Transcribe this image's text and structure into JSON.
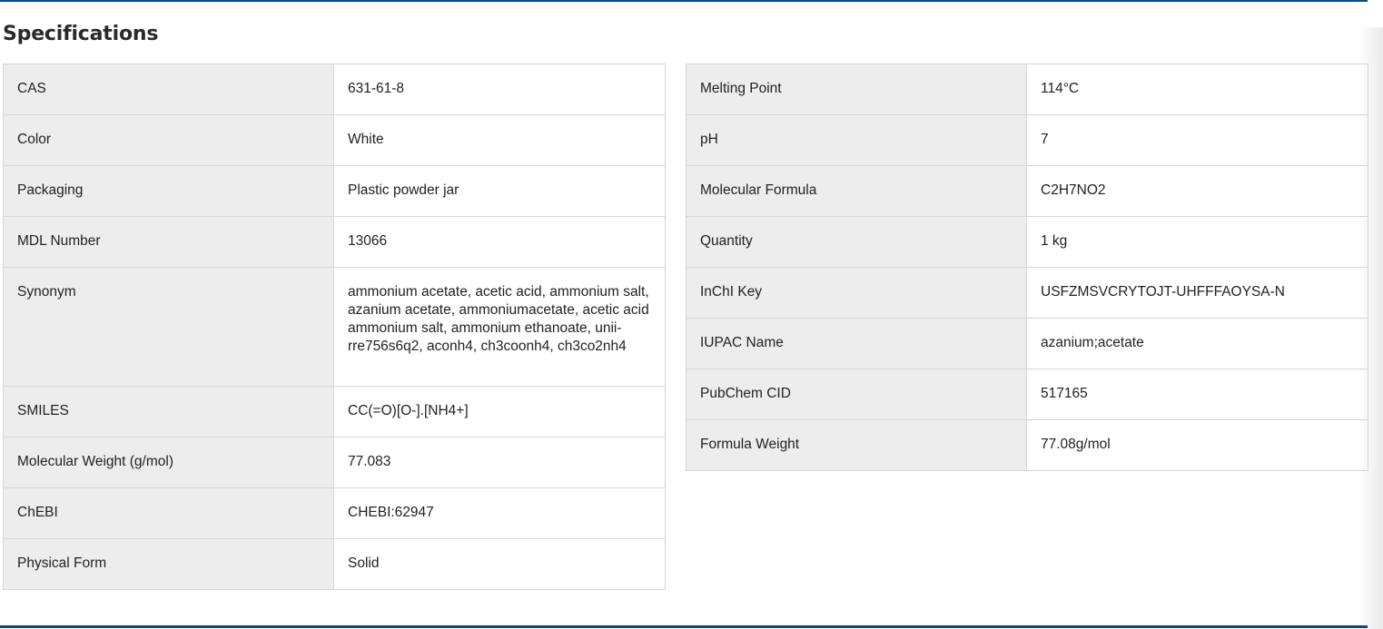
{
  "section": {
    "title": "Specifications"
  },
  "left_rows": [
    {
      "label": "CAS",
      "value": "631-61-8"
    },
    {
      "label": "Color",
      "value": "White"
    },
    {
      "label": "Packaging",
      "value": "Plastic powder jar"
    },
    {
      "label": "MDL Number",
      "value": "13066"
    },
    {
      "label": "Synonym",
      "value": "ammonium acetate, acetic acid, ammonium salt, azanium acetate, ammoniumacetate, acetic acid ammonium salt, ammonium ethanoate, unii-rre756s6q2, aconh4, ch3coonh4, ch3co2nh4"
    },
    {
      "label": "SMILES",
      "value": "CC(=O)[O-].[NH4+]"
    },
    {
      "label": "Molecular Weight (g/mol)",
      "value": "77.083"
    },
    {
      "label": "ChEBI",
      "value": "CHEBI:62947"
    },
    {
      "label": "Physical Form",
      "value": "Solid"
    }
  ],
  "right_rows": [
    {
      "label": "Melting Point",
      "value": "114°C"
    },
    {
      "label": "pH",
      "value": "7"
    },
    {
      "label": "Molecular Formula",
      "value": "C2H7NO2"
    },
    {
      "label": "Quantity",
      "value": "1 kg"
    },
    {
      "label": "InChI Key",
      "value": "USFZMSVCRYTOJT-UHFFFAOYSA-N"
    },
    {
      "label": "IUPAC Name",
      "value": "azanium;acetate"
    },
    {
      "label": "PubChem CID",
      "value": "517165"
    },
    {
      "label": "Formula Weight",
      "value": "77.08g/mol"
    }
  ],
  "colors": {
    "accent_rule": "#0b4a86",
    "label_background": "#eeeded",
    "border": "#d6d6d6"
  }
}
